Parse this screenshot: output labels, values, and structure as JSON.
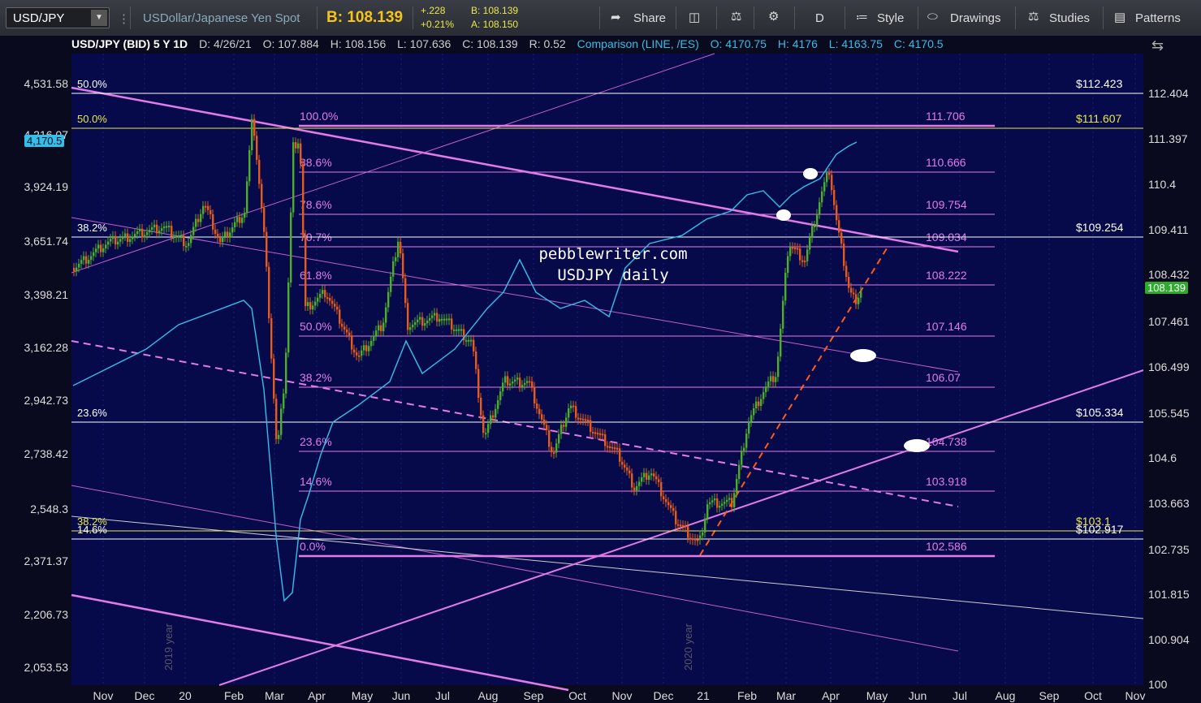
{
  "toolbar": {
    "symbol": "USD/JPY",
    "description": "USDollar/Japanese Yen Spot",
    "bid_label": "B: 108.139",
    "change": "+.228",
    "change_pct": "+0.21%",
    "bid_small": "B: 108.139",
    "ask_small": "A: 108.150",
    "share": "Share",
    "timeframe": "D",
    "style": "Style",
    "drawings": "Drawings",
    "studies": "Studies",
    "patterns": "Patterns"
  },
  "header": {
    "title": "USD/JPY (BID) 5 Y 1D",
    "date": "D: 4/26/21",
    "open": "O: 107.884",
    "high": "H: 108.156",
    "low": "L: 107.636",
    "close": "C: 108.139",
    "r": "R: 0.52",
    "comparison": "Comparison (LINE, /ES)",
    "c_open": "O: 4170.75",
    "c_high": "H: 4176",
    "c_low": "L: 4163.75",
    "c_close": "C: 4170.5"
  },
  "watermark": [
    "pebblewriter.com",
    "USDJPY daily"
  ],
  "left_axis": [
    "4,531.58",
    "4,216.07",
    "3,924.19",
    "3,651.74",
    "3,398.21",
    "3,162.28",
    "2,942.73",
    "2,738.42",
    "2,548.3",
    "2,371.37",
    "2,206.73",
    "2,053.53"
  ],
  "right_axis": [
    "112.404",
    "111.397",
    "110.4",
    "109.411",
    "108.432",
    "107.461",
    "106.499",
    "105.545",
    "104.6",
    "103.663",
    "102.735",
    "101.815",
    "100.904",
    "100"
  ],
  "x_axis": [
    "Nov",
    "Dec",
    "20",
    "Feb",
    "Mar",
    "Apr",
    "May",
    "Jun",
    "Jul",
    "Aug",
    "Sep",
    "Oct",
    "Nov",
    "Dec",
    "21",
    "Feb",
    "Mar",
    "Apr",
    "May",
    "Jun",
    "Jul",
    "Aug",
    "Sep",
    "Oct",
    "Nov"
  ],
  "year_labels": [
    "2019 year",
    "2020 year"
  ],
  "current_tags": {
    "left": "4,170.5",
    "right": "108.139"
  },
  "fib_inner": [
    {
      "pct": "100.0%",
      "price": "111.706"
    },
    {
      "pct": "88.6%",
      "price": "110.666"
    },
    {
      "pct": "78.6%",
      "price": "109.754"
    },
    {
      "pct": "70.7%",
      "price": "109.034"
    },
    {
      "pct": "61.8%",
      "price": "108.222"
    },
    {
      "pct": "50.0%",
      "price": "107.146"
    },
    {
      "pct": "38.2%",
      "price": "106.07"
    },
    {
      "pct": "23.6%",
      "price": "104.738"
    },
    {
      "pct": "14.6%",
      "price": "103.918"
    },
    {
      "pct": "0.0%",
      "price": "102.586"
    }
  ],
  "fib_outer": [
    {
      "pct": "50.0%",
      "price": "$112.423"
    },
    {
      "pct": "50.0%",
      "price": "$111.607"
    },
    {
      "pct": "38.2%",
      "price": "$109.254"
    },
    {
      "pct": "23.6%",
      "price": "$105.334"
    },
    {
      "pct": "38.2%",
      "price": "$103.1"
    },
    {
      "pct": "14.6%",
      "price": "$102.917"
    }
  ],
  "colors": {
    "fib_pink": "#e27be8",
    "fib_white": "#ffffff",
    "fib_yellow": "#e8e84a",
    "candle_up": "#4caf2a",
    "candle_down": "#e85a1a",
    "comparison": "#33bfe8",
    "accent": "#f5c518"
  }
}
